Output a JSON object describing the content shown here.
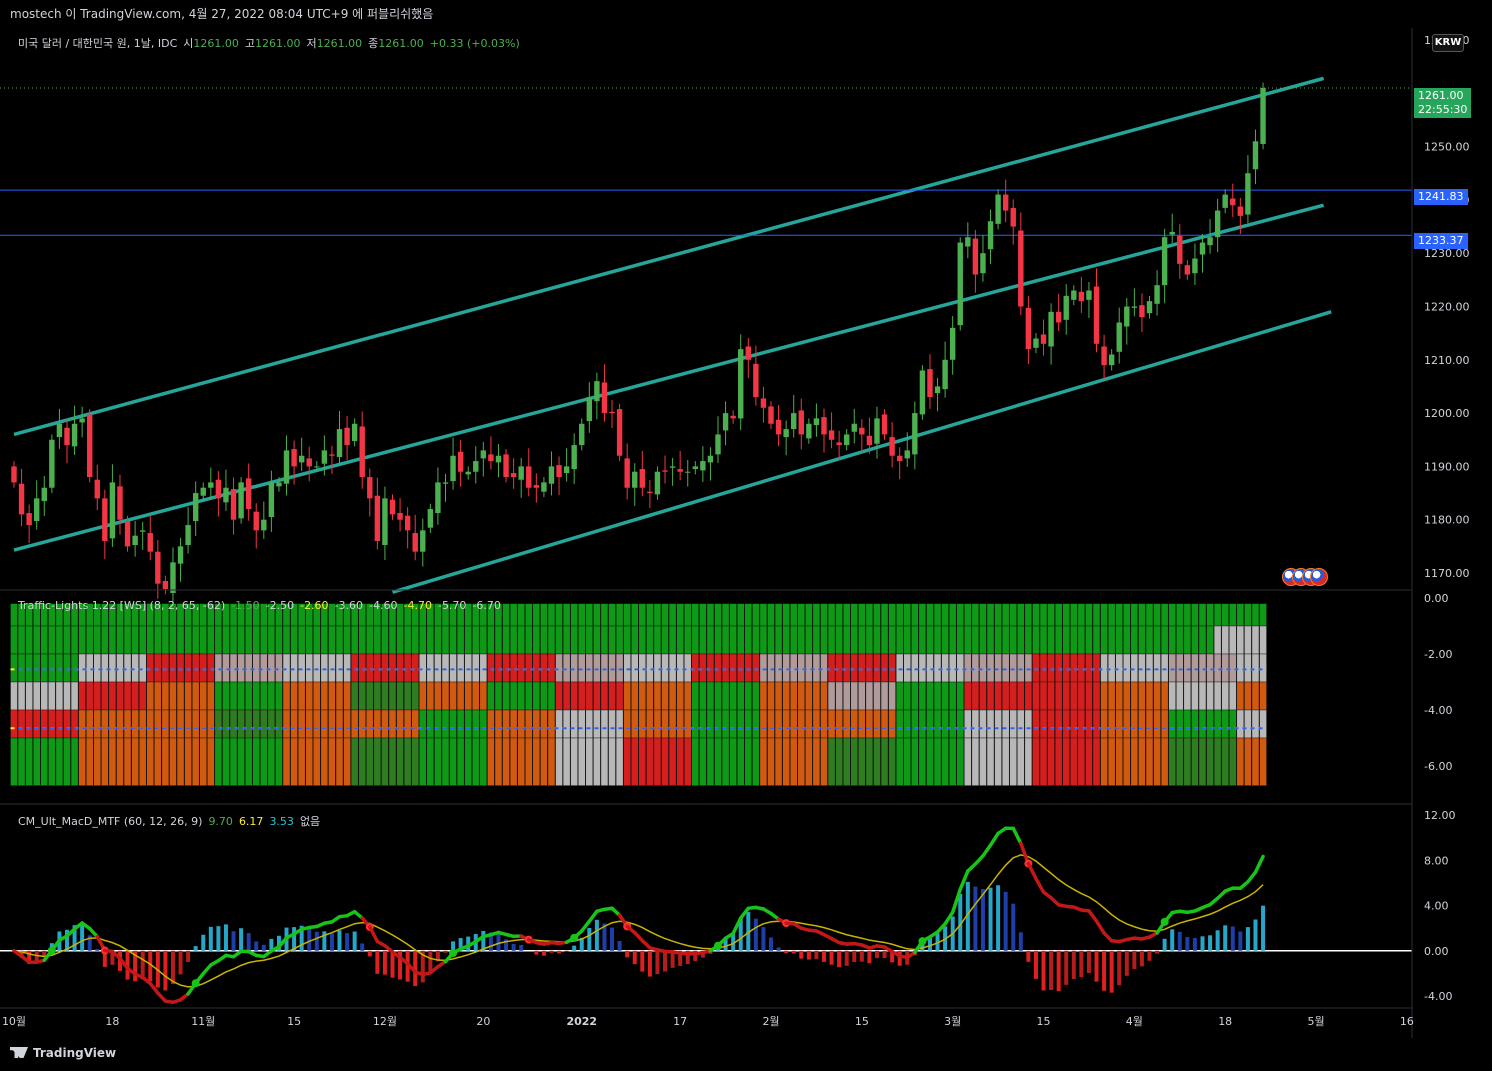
{
  "header": {
    "title": "mostech 이 TradingView.com, 4월 27, 2022 08:04 UTC+9 에 퍼블리쉬했음"
  },
  "main_legend": {
    "symbol": "미국 달러 / 대한민국 원, 1날, IDC",
    "open_label": "시",
    "open": "1261.00",
    "high_label": "고",
    "high": "1261.00",
    "low_label": "저",
    "low": "1261.00",
    "close_label": "종",
    "close": "1261.00",
    "change": "+0.33 (+0.03%)"
  },
  "currency_button": "KRW",
  "price_labels": {
    "last": "1261.00",
    "countdown": "22:55:30",
    "line1": "1241.83",
    "line2": "1233.37"
  },
  "indicator1_legend": {
    "name": "Traffic-Lights 1.22 [WS] (8, 2, 65, -62)",
    "values": [
      "-1.50",
      "-2.50",
      "-2.60",
      "-3.60",
      "-4.60",
      "-4.70",
      "-5.70",
      "-6.70"
    ]
  },
  "indicator2_legend": {
    "name": "CM_Ult_MacD_MTF (60, 12, 26, 9)",
    "v1": "9.70",
    "v2": "6.17",
    "v3": "3.53",
    "v4": "없음"
  },
  "footer": {
    "brand": "TradingView"
  },
  "colors": {
    "up": "#4caf50",
    "down": "#f23645",
    "channel": "#26a69a",
    "hline": "#2962ff",
    "macd": "#00c000",
    "signal": "#c8b400",
    "hist_up": "#26a6c8",
    "hist_down": "#b71c1c",
    "background": "#000000"
  },
  "chart_data": [
    {
      "type": "candlestick",
      "ylim": [
        1165,
        1267
      ],
      "y_ticks": [
        "1270.00",
        "1260.00",
        "1250.00",
        "1240.00",
        "1230.00",
        "1220.00",
        "1210.00",
        "1200.00",
        "1190.00",
        "1180.00",
        "1170.00"
      ],
      "x_ticks": [
        "10월",
        "18",
        "11월",
        "15",
        "12월",
        "20",
        "2022",
        "17",
        "2월",
        "15",
        "3월",
        "15",
        "4월",
        "18",
        "5월",
        "16"
      ],
      "closes": [
        1187,
        1181,
        1179,
        1184,
        1186,
        1195,
        1198,
        1194,
        1198,
        1199,
        1188,
        1184,
        1176,
        1187,
        1180,
        1175,
        1177,
        1178,
        1174,
        1168,
        1167,
        1172,
        1175,
        1179,
        1185,
        1186,
        1187,
        1184,
        1186,
        1180,
        1187,
        1182,
        1178,
        1180,
        1187,
        1187,
        1193,
        1190,
        1192,
        1190,
        1190,
        1193,
        1192,
        1197,
        1194,
        1198,
        1188,
        1184,
        1176,
        1184,
        1181,
        1180,
        1178,
        1174,
        1178,
        1182,
        1187,
        1187,
        1192,
        1189,
        1189,
        1191,
        1193,
        1191,
        1192,
        1188,
        1188,
        1190,
        1186,
        1186,
        1187,
        1190,
        1188,
        1190,
        1194,
        1198,
        1203,
        1206,
        1200,
        1200,
        1192,
        1186,
        1189,
        1186,
        1185,
        1189,
        1189,
        1190,
        1189,
        1189,
        1190,
        1191,
        1192,
        1196,
        1200,
        1199,
        1212,
        1210,
        1203,
        1201,
        1198,
        1196,
        1197,
        1200,
        1196,
        1198,
        1199,
        1196,
        1195,
        1194,
        1196,
        1198,
        1196,
        1194,
        1199,
        1196,
        1192,
        1191,
        1193,
        1200,
        1208,
        1203,
        1205,
        1210,
        1216,
        1232,
        1233,
        1226,
        1230,
        1236,
        1241,
        1238,
        1235,
        1220,
        1212,
        1214,
        1213,
        1219,
        1217,
        1222,
        1223,
        1221,
        1223,
        1213,
        1209,
        1211,
        1217,
        1220,
        1220,
        1218,
        1221,
        1224,
        1233,
        1234,
        1228,
        1226,
        1229,
        1232,
        1233,
        1238,
        1241,
        1239,
        1237,
        1245,
        1251,
        1261
      ],
      "channel_lines": [
        {
          "from": [
            0,
            1196
          ],
          "to": [
            173,
            1262.8
          ]
        },
        {
          "from": [
            0,
            1174.3
          ],
          "to": [
            173,
            1239
          ]
        },
        {
          "from": [
            50,
            1166.4
          ],
          "to": [
            174,
            1219
          ]
        }
      ],
      "horizontal_lines": [
        1241.83,
        1233.37,
        1261.0
      ]
    },
    {
      "type": "heatmap",
      "title": "Traffic-Lights",
      "ylim": [
        -7,
        0
      ],
      "y_ticks": [
        "0.00",
        "-2.00",
        "-4.00",
        "-6.00"
      ],
      "rows": 6,
      "legend": [
        "green",
        "red",
        "orange",
        "darkgreen",
        "lightgray",
        "rosybrown"
      ]
    },
    {
      "type": "line",
      "title": "CM_Ult_MacD_MTF",
      "ylim": [
        -4.2,
        12
      ],
      "y_ticks": [
        "12.00",
        "8.00",
        "4.00",
        "0.00",
        "-4.00"
      ]
    }
  ]
}
